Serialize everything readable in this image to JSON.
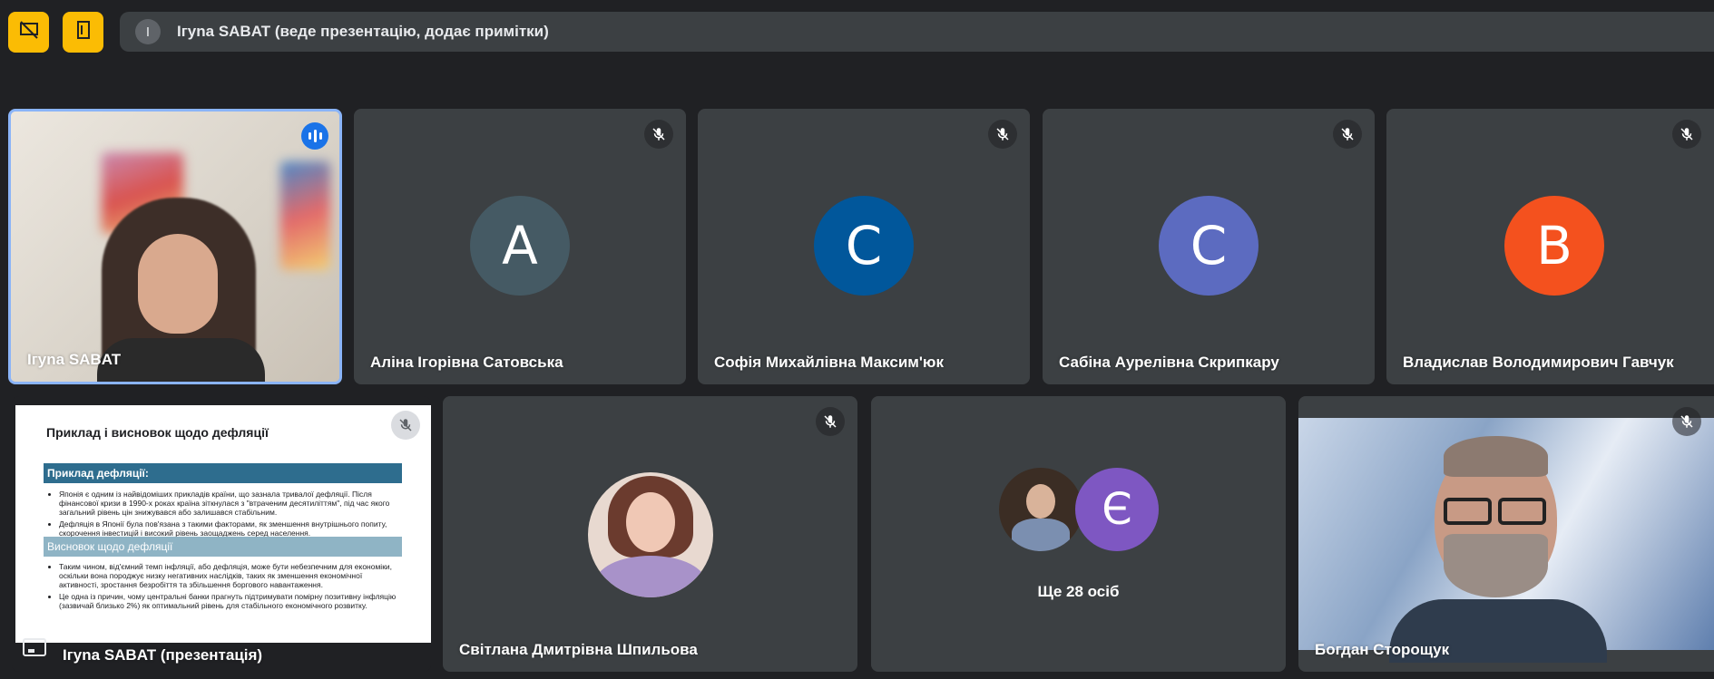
{
  "topbar": {
    "initial": "І",
    "title": "Ігуna SABAT (веде презентацію, додає примітки)"
  },
  "colors": {
    "accent_yellow": "#fbbc04",
    "speaking_blue": "#1a73e8",
    "tile_bg": "#3c4043",
    "background": "#202124"
  },
  "participants": [
    {
      "name": "Ігуna SABAT",
      "speaking": true
    },
    {
      "name": "Аліна Ігорівна Сатовська",
      "initial": "A",
      "color": "#455a64"
    },
    {
      "name": "Софія Михайлівна Максим'юк",
      "initial": "С",
      "color": "#01579b"
    },
    {
      "name": "Сабіна Аурелівна Скрипкару",
      "initial": "С",
      "color": "#5c6bc0"
    },
    {
      "name": "Владислав Володимирович Гавчук",
      "initial": "В",
      "color": "#f4511e"
    },
    {
      "name": "Світлана Дмитрівна Шпильова"
    },
    {
      "name": "Богдан Сторощук"
    }
  ],
  "more_tile": {
    "initial": "Є",
    "color": "#7e57c2",
    "label": "Ще 28 осіб"
  },
  "presentation": {
    "owner_label": "Ігуna SABAT (презентація)",
    "title": "Приклад і висновок щодо дефляції",
    "section1": "Приклад дефляції:",
    "bullets1": [
      "Японія є одним із найвідоміших прикладів країни, що зазнала тривалої дефляції. Після фінансової кризи в 1990-х роках країна зіткнулася з \"втраченим десятиліттям\", під час якого загальний рівень цін знижувався або залишався стабільним.",
      "Дефляція в Японії була пов'язана з такими факторами, як зменшення внутрішнього попиту, скорочення інвестицій і високий рівень заощаджень серед населення."
    ],
    "section2": "Висновок щодо дефляції",
    "bullets2": [
      "Таким чином, від'ємний темп інфляції, або дефляція, може бути небезпечним для економіки, оскільки вона породжує низку негативних наслідків, таких як зменшення економічної активності, зростання безробіття та збільшення боргового навантаження.",
      "Це одна із причин, чому центральні банки прагнуть підтримувати помірну позитивну інфляцію (зазвичай близько 2%) як оптимальний рівень для стабільного економічного розвитку."
    ]
  }
}
